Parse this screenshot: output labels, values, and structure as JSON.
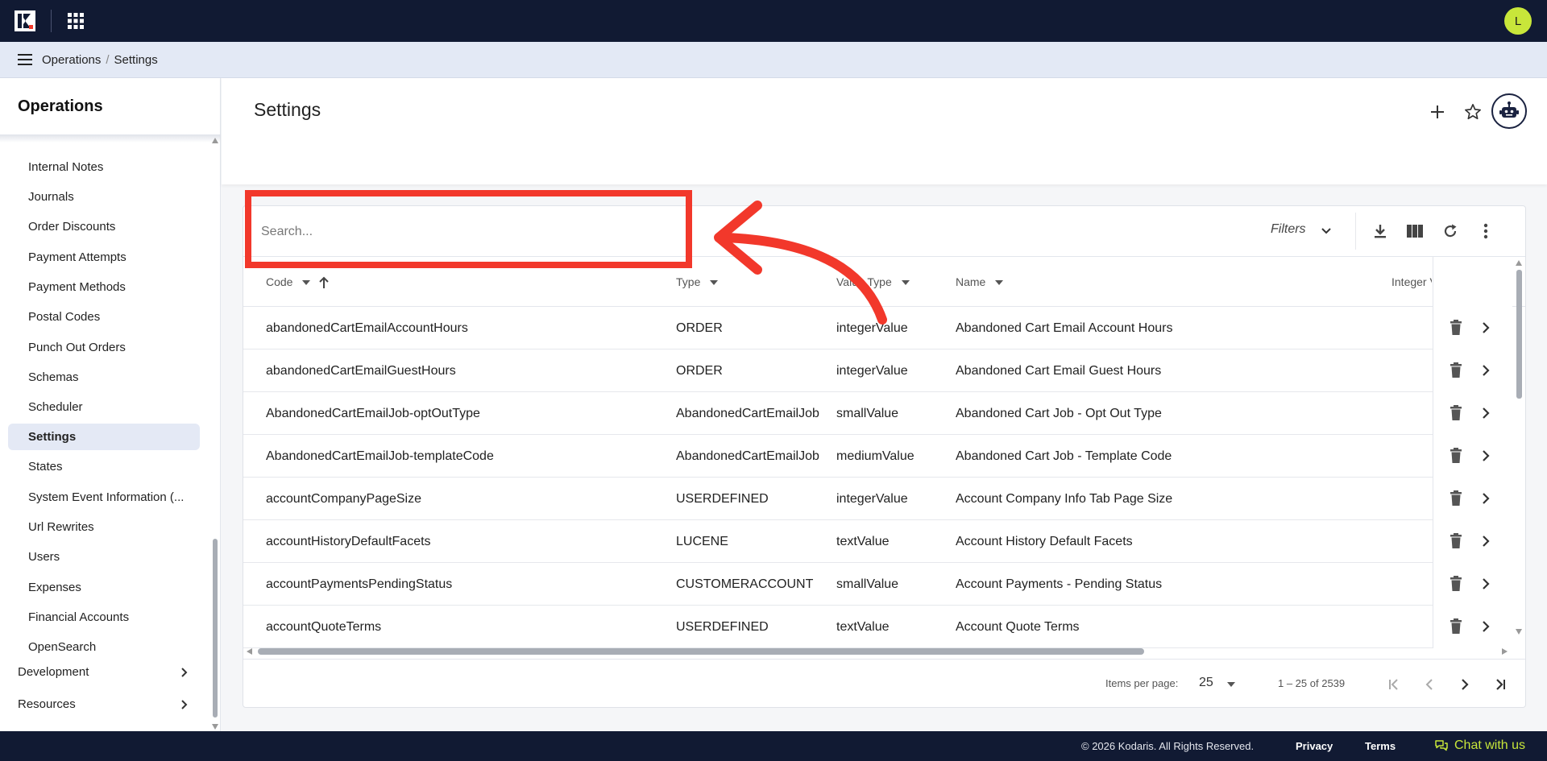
{
  "topbar": {
    "avatar_initial": "L"
  },
  "breadcrumb": {
    "root": "Operations",
    "separator": "/",
    "current": "Settings"
  },
  "sidebar": {
    "title": "Operations",
    "items": [
      {
        "label": "Internal Notes"
      },
      {
        "label": "Journals"
      },
      {
        "label": "Order Discounts"
      },
      {
        "label": "Payment Attempts"
      },
      {
        "label": "Payment Methods"
      },
      {
        "label": "Postal Codes"
      },
      {
        "label": "Punch Out Orders"
      },
      {
        "label": "Schemas"
      },
      {
        "label": "Scheduler"
      },
      {
        "label": "Settings",
        "active": true
      },
      {
        "label": "States"
      },
      {
        "label": "System Event Information (..."
      },
      {
        "label": "Url Rewrites"
      },
      {
        "label": "Users"
      },
      {
        "label": "Expenses"
      },
      {
        "label": "Financial Accounts"
      },
      {
        "label": "OpenSearch"
      }
    ],
    "groups": [
      {
        "label": "Development"
      },
      {
        "label": "Resources"
      }
    ]
  },
  "page": {
    "title": "Settings"
  },
  "toolbar": {
    "search_placeholder": "Search...",
    "search_value": "",
    "filters_label": "Filters"
  },
  "table": {
    "columns": {
      "code": "Code",
      "type": "Type",
      "value_type": "Value Type",
      "name": "Name",
      "integer_value": "Integer V"
    },
    "rows": [
      {
        "code": "abandonedCartEmailAccountHours",
        "type": "ORDER",
        "value_type": "integerValue",
        "name": "Abandoned Cart Email Account Hours"
      },
      {
        "code": "abandonedCartEmailGuestHours",
        "type": "ORDER",
        "value_type": "integerValue",
        "name": "Abandoned Cart Email Guest Hours"
      },
      {
        "code": "AbandonedCartEmailJob-optOutType",
        "type": "AbandonedCartEmailJob",
        "value_type": "smallValue",
        "name": "Abandoned Cart Job - Opt Out Type"
      },
      {
        "code": "AbandonedCartEmailJob-templateCode",
        "type": "AbandonedCartEmailJob",
        "value_type": "mediumValue",
        "name": "Abandoned Cart Job - Template Code"
      },
      {
        "code": "accountCompanyPageSize",
        "type": "USERDEFINED",
        "value_type": "integerValue",
        "name": "Account Company Info Tab Page Size"
      },
      {
        "code": "accountHistoryDefaultFacets",
        "type": "LUCENE",
        "value_type": "textValue",
        "name": "Account History Default Facets"
      },
      {
        "code": "accountPaymentsPendingStatus",
        "type": "CUSTOMERACCOUNT",
        "value_type": "smallValue",
        "name": "Account Payments - Pending Status"
      },
      {
        "code": "accountQuoteTerms",
        "type": "USERDEFINED",
        "value_type": "textValue",
        "name": "Account Quote Terms"
      }
    ]
  },
  "paginator": {
    "items_per_page_label": "Items per page:",
    "items_per_page": "25",
    "range": "1 – 25 of 2539"
  },
  "footer": {
    "copyright": "© 2026 Kodaris. All Rights Reserved.",
    "privacy": "Privacy",
    "terms": "Terms",
    "chat": "Chat with us"
  },
  "colors": {
    "topbar": "#111a33",
    "accent_lime": "#c8e63a",
    "annotation_red": "#f2382b",
    "active_nav": "#e4e9f5"
  },
  "icons": [
    "logo-icon",
    "apps-grid-icon",
    "menu-icon",
    "plus-icon",
    "star-icon",
    "help-icon",
    "robot-icon",
    "download-icon",
    "columns-icon",
    "refresh-icon",
    "more-vert-icon",
    "delete-icon",
    "chevron-right-icon",
    "first-page-icon",
    "prev-page-icon",
    "next-page-icon",
    "last-page-icon",
    "chat-icon"
  ]
}
